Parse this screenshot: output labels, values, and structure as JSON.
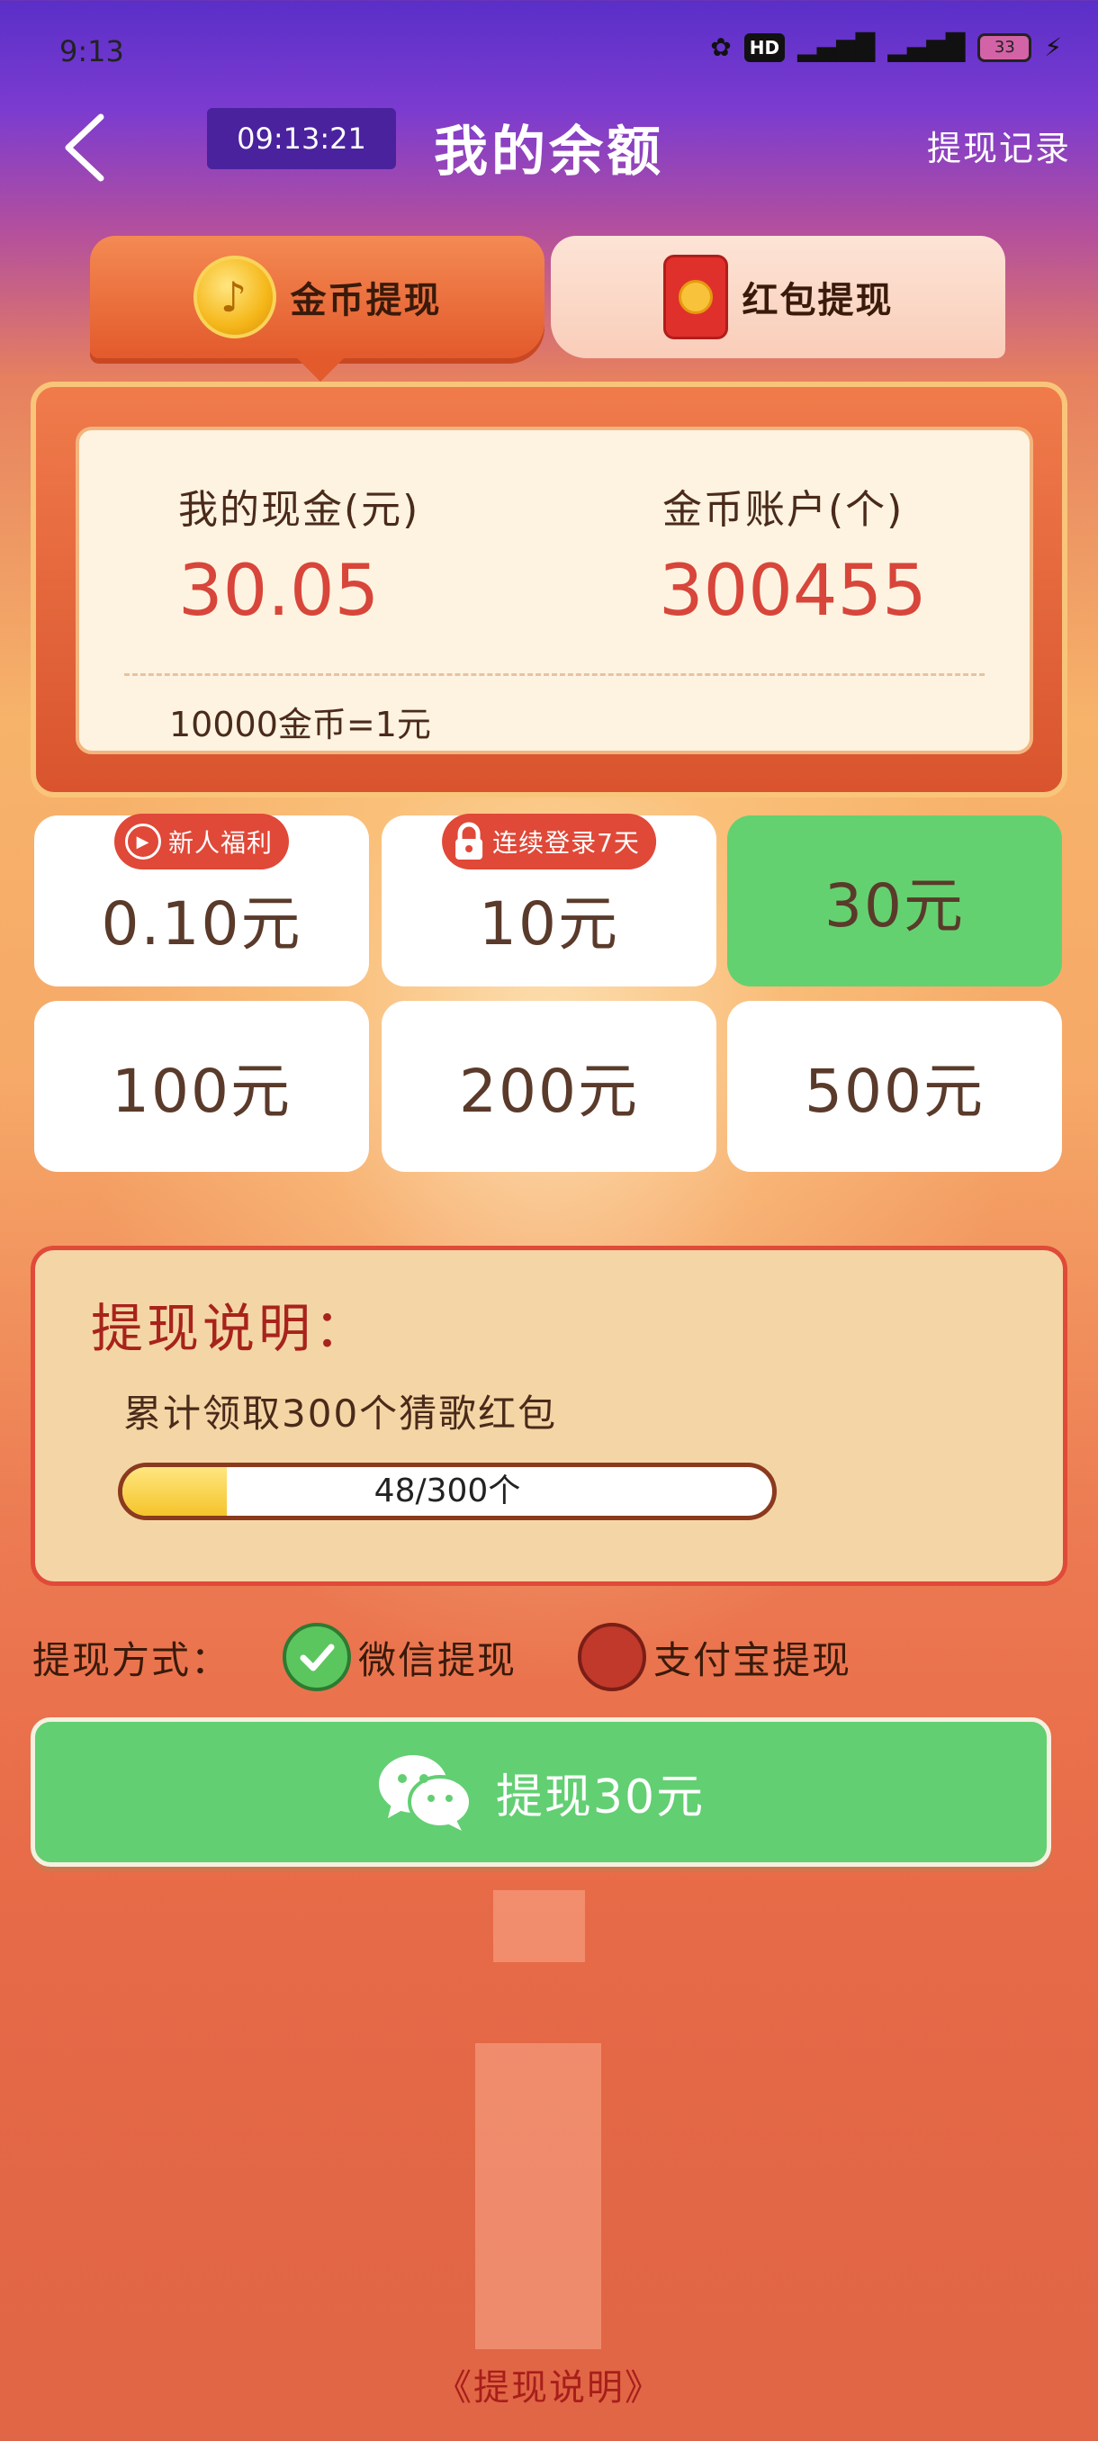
{
  "status_bar": {
    "time": "9:13",
    "hd_label": "HD",
    "battery": "33"
  },
  "nav": {
    "timer": "09:13:21",
    "title": "我的余额",
    "history_link": "提现记录"
  },
  "tabs": [
    {
      "label": "金币提现",
      "active": true
    },
    {
      "label": "红包提现",
      "active": false
    }
  ],
  "balance": {
    "cash_label": "我的现金(元)",
    "cash_value": "30.05",
    "coins_label": "金币账户(个)",
    "coins_value": "300455",
    "rate": "10000金币=1元"
  },
  "amounts": [
    {
      "label": "0.10元",
      "tag": "新人福利",
      "tag_icon": "play-icon",
      "selected": false
    },
    {
      "label": "10元",
      "tag": "连续登录7天",
      "tag_icon": "lock-icon",
      "selected": false
    },
    {
      "label": "30元",
      "tag": null,
      "selected": true
    },
    {
      "label": "100元",
      "tag": null,
      "selected": false
    },
    {
      "label": "200元",
      "tag": null,
      "selected": false
    },
    {
      "label": "500元",
      "tag": null,
      "selected": false
    }
  ],
  "explain": {
    "title": "提现说明：",
    "desc": "累计领取300个猜歌红包",
    "progress_text": "48/300个",
    "progress_current": 48,
    "progress_total": 300
  },
  "method": {
    "label": "提现方式：",
    "options": [
      {
        "label": "微信提现",
        "selected": true
      },
      {
        "label": "支付宝提现",
        "selected": false
      }
    ]
  },
  "withdraw_button": {
    "label": "提现30元"
  },
  "footer": {
    "link": "《提现说明》"
  },
  "colors": {
    "selected_green": "#64d170",
    "tag_red": "#e04838",
    "value_red": "#d8453a",
    "button_green": "#62cf72"
  }
}
